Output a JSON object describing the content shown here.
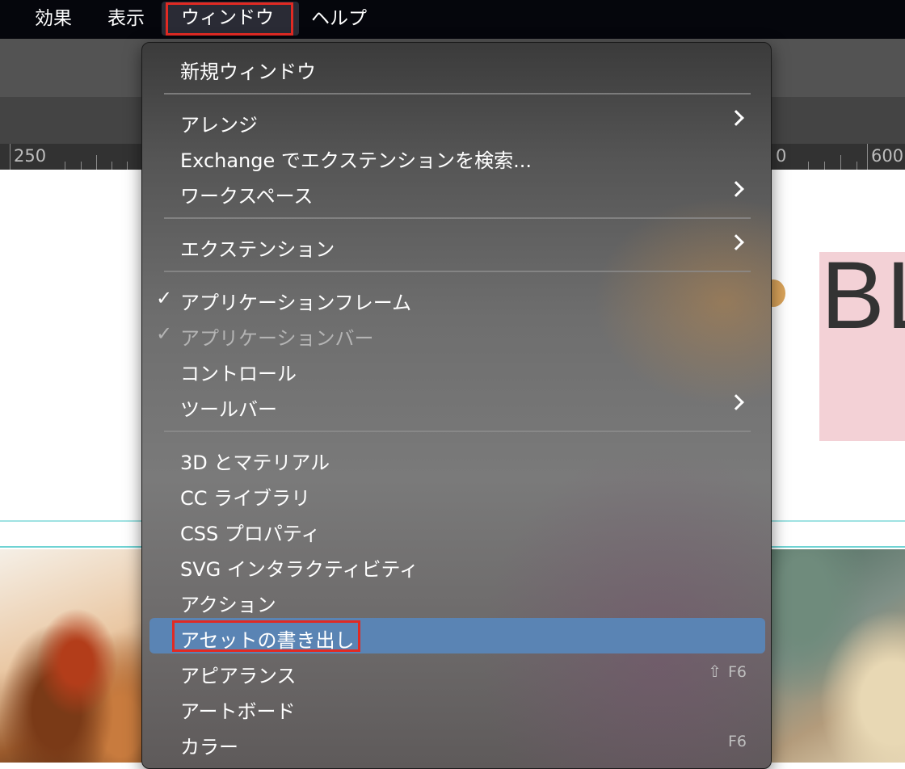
{
  "menubar": {
    "effect": "効果",
    "view": "表示",
    "window": "ウィンドウ",
    "help": "ヘルプ"
  },
  "ruler": {
    "label_left": "250",
    "label_mid": "0",
    "label_right": "600"
  },
  "canvas": {
    "big_text": "BL"
  },
  "menu": {
    "new_window": "新規ウィンドウ",
    "arrange": "アレンジ",
    "exchange": "Exchange でエクステンションを検索...",
    "workspace": "ワークスペース",
    "extensions": "エクステンション",
    "application_frame": "アプリケーションフレーム",
    "application_bar": "アプリケーションバー",
    "control": "コントロール",
    "toolbar": "ツールバー",
    "materials_3d": "3D とマテリアル",
    "cc_libraries": "CC ライブラリ",
    "css_properties": "CSS プロパティ",
    "svg_interactivity": "SVG インタラクティビティ",
    "actions": "アクション",
    "asset_export": "アセットの書き出し",
    "appearance": "アピアランス",
    "appearance_shortcut": "F6",
    "artboards": "アートボード",
    "color": "カラー",
    "color_shortcut": "F6",
    "check_mark": "✓"
  },
  "colors": {
    "highlight": "#5a84b4",
    "annotation_red": "#e12a23",
    "menubar_bg": "#05060c"
  }
}
